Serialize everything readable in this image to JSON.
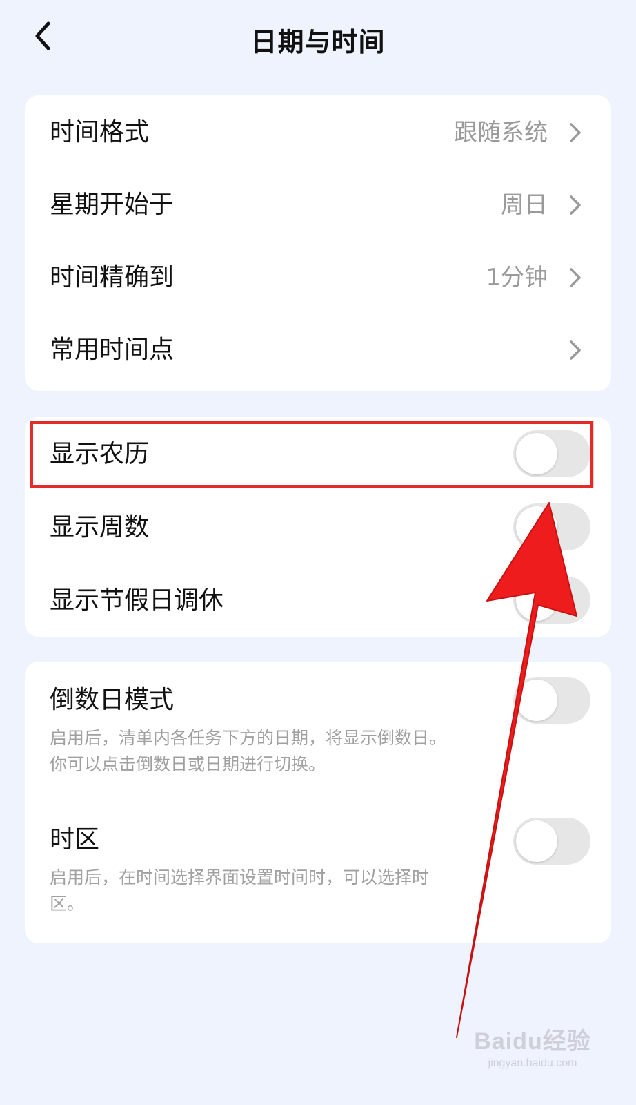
{
  "header": {
    "title": "日期与时间"
  },
  "card1": {
    "rows": [
      {
        "label": "时间格式",
        "value": "跟随系统"
      },
      {
        "label": "星期开始于",
        "value": "周日"
      },
      {
        "label": "时间精确到",
        "value": "1分钟"
      },
      {
        "label": "常用时间点",
        "value": ""
      }
    ]
  },
  "card2": {
    "rows": [
      {
        "label": "显示农历",
        "toggle": false
      },
      {
        "label": "显示周数",
        "toggle": false
      },
      {
        "label": "显示节假日调休",
        "toggle": false
      }
    ]
  },
  "card3": {
    "rows": [
      {
        "label": "倒数日模式",
        "desc_line1": "启用后，清单内各任务下方的日期，将显示倒数日。",
        "desc_line2": "你可以点击倒数日或日期进行切换。",
        "toggle": false
      },
      {
        "label": "时区",
        "desc_line1": "启用后，在时间选择界面设置时间时，可以选择时",
        "desc_line2": "区。",
        "toggle": false
      }
    ]
  },
  "watermark": {
    "brand": "Baidu经验",
    "url": "jingyan.baidu.com"
  },
  "colors": {
    "background": "#eff3fd",
    "card": "#ffffff",
    "toggle_off": "#e6e6e6",
    "annotation": "#e52a2a"
  }
}
